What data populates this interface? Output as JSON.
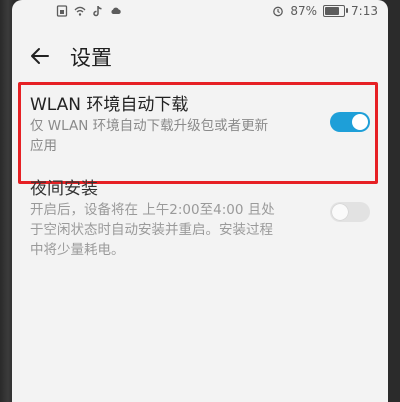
{
  "statusbar": {
    "battery_text": "87%",
    "time": "7:13",
    "battery_level": 0.87,
    "icons": [
      "sim-icon",
      "wifi-icon",
      "tiktok-icon",
      "cloud-icon",
      "alarm-icon",
      "battery-icon"
    ]
  },
  "header": {
    "title": "设置"
  },
  "wlan_download": {
    "title": "WLAN 环境自动下载",
    "description": "仅 WLAN 环境自动下载升级包或者更新\n应用",
    "enabled": true
  },
  "night_install": {
    "title": "夜间安装",
    "description": "开启后，设备将在 上午2:00至4:00 且处\n于空闲状态时自动安装并重启。安装过程\n中将少量耗电。",
    "enabled": false
  },
  "colors": {
    "toggle_on": "#1e9fd8",
    "highlight": "#e62024"
  }
}
